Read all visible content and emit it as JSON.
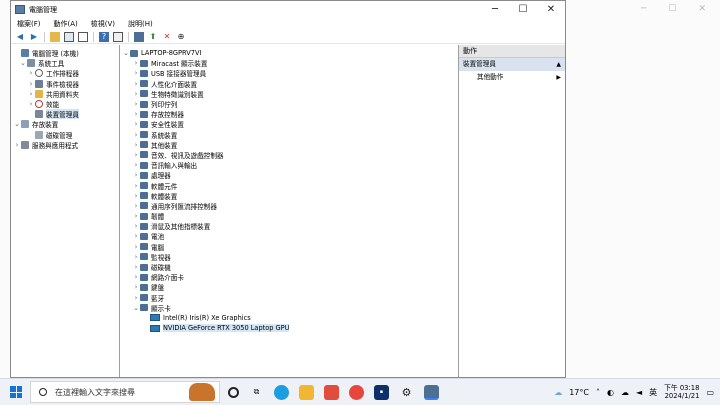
{
  "window": {
    "title": "電腦管理",
    "controls": [
      "─",
      "☐",
      "✕"
    ]
  },
  "menu": [
    "檔案(F)",
    "動作(A)",
    "檢視(V)",
    "說明(H)"
  ],
  "left_tree": [
    {
      "label": "電腦管理 (本機)",
      "level": 0,
      "expander": ""
    },
    {
      "label": "系統工具",
      "level": 1,
      "expander": "⌄"
    },
    {
      "label": "工作排程器",
      "level": 2,
      "expander": "›"
    },
    {
      "label": "事件檢視器",
      "level": 2,
      "expander": "›"
    },
    {
      "label": "共用資料夾",
      "level": 2,
      "expander": "›"
    },
    {
      "label": "效能",
      "level": 2,
      "expander": "›"
    },
    {
      "label": "裝置管理員",
      "level": 2,
      "expander": "",
      "selected": true
    },
    {
      "label": "存放裝置",
      "level": 1,
      "expander": "⌄"
    },
    {
      "label": "磁碟管理",
      "level": 2,
      "expander": ""
    },
    {
      "label": "服務與應用程式",
      "level": 1,
      "expander": "›"
    }
  ],
  "device_tree": {
    "root": "LAPTOP-8GPRV7VI",
    "categories": [
      "Miracast 顯示裝置",
      "USB 接接器管理員",
      "人性化介面裝置",
      "生物特徵識別裝置",
      "列印佇列",
      "存放控制器",
      "安全性裝置",
      "系統裝置",
      "其他裝置",
      "音效、視訊及遊戲控制器",
      "音訊輸入與輸出",
      "處理器",
      "軟體元件",
      "軟體裝置",
      "通用序列匯流排控制器",
      "韌體",
      "滑鼠及其他指標裝置",
      "電池",
      "電腦",
      "監視器",
      "磁碟機",
      "網路介面卡",
      "鍵盤",
      "藍牙"
    ],
    "expanded_category": "顯示卡",
    "display_adapters": [
      "Intel(R) Iris(R) Xe Graphics",
      "NVIDIA GeForce RTX 3050 Laptop GPU"
    ]
  },
  "actions": {
    "header": "動作",
    "group": "裝置管理員",
    "item": "其他動作"
  },
  "taskbar": {
    "search_placeholder": "在這裡輸入文字來搜尋",
    "weather": "17°C",
    "ime": "英",
    "time": "下午 03:18",
    "date": "2024/1/21"
  },
  "colors": {
    "accent": "#1673d6",
    "selection": "#d4e5f5"
  }
}
